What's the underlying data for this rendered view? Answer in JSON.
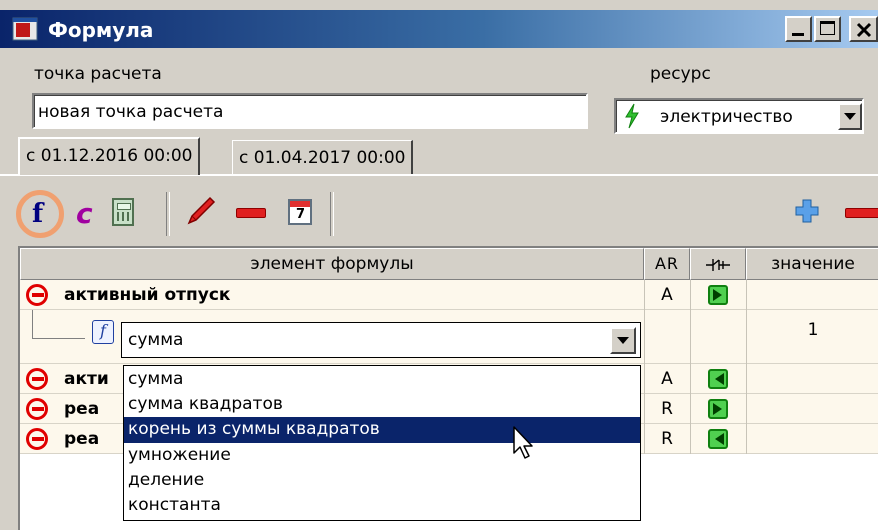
{
  "window": {
    "title": "Формула"
  },
  "form": {
    "point_label": "точка расчета",
    "point_value": "новая точка расчета",
    "resource_label": "ресурс",
    "resource_value": "электричество"
  },
  "tabs": [
    {
      "label": "с 01.12.2016 00:00",
      "active": true
    },
    {
      "label": "с 01.04.2017 00:00",
      "active": false
    }
  ],
  "toolbar": {
    "icons": [
      "function-icon",
      "constant-icon",
      "calculator-icon",
      "pencil-icon",
      "minus-icon",
      "calendar-icon",
      "add-icon",
      "remove-icon"
    ],
    "function_glyph": "f",
    "constant_glyph": "c",
    "calendar_day": "7",
    "highlight_color": "#f0a070"
  },
  "grid": {
    "headers": {
      "element": "элемент формулы",
      "ar": "AR",
      "direction_icon": "flow-direction-icon",
      "value": "значение"
    },
    "rows": [
      {
        "name": "активный отпуск",
        "ar": "A",
        "flow": "out",
        "value": ""
      },
      {
        "name": "сумма",
        "ar": "",
        "flow": "",
        "value": "1",
        "is_function": true
      },
      {
        "name": "акти",
        "ar": "A",
        "flow": "in",
        "value": ""
      },
      {
        "name": "реа",
        "ar": "R",
        "flow": "out",
        "value": ""
      },
      {
        "name": "реа",
        "ar": "R",
        "flow": "in",
        "value": ""
      }
    ]
  },
  "dropdown": {
    "selected": "сумма",
    "options": [
      "сумма",
      "сумма квадратов",
      "корень из суммы квадратов",
      "умножение",
      "деление",
      "константа"
    ],
    "highlighted_index": 2
  },
  "colors": {
    "titlebar": "#0a246a",
    "selection": "#0a246a",
    "accent_red": "#e00000",
    "row_bg": "#fdf8ec"
  }
}
